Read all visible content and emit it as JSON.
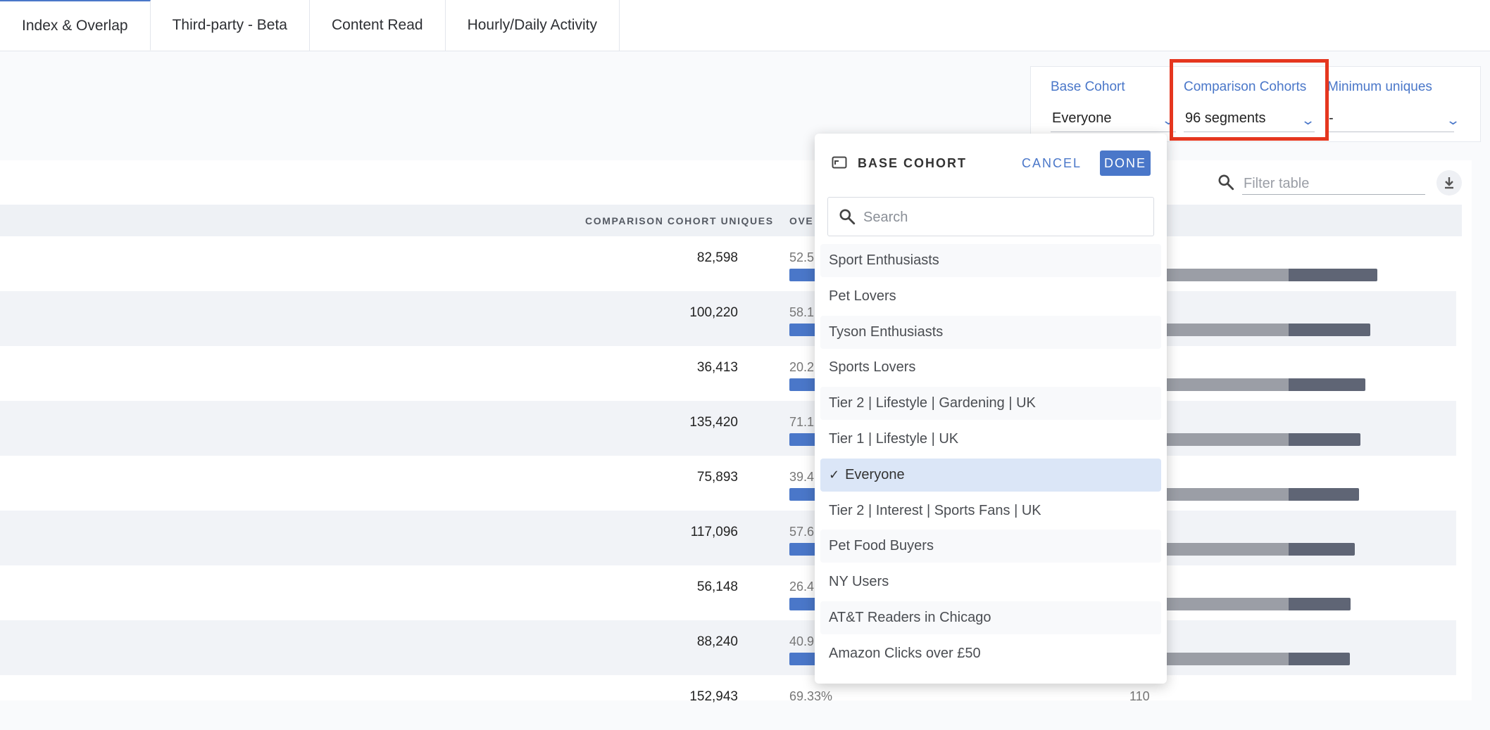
{
  "tabs": [
    {
      "label": "Index & Overlap",
      "active": true
    },
    {
      "label": "Third-party - Beta",
      "active": false
    },
    {
      "label": "Content Read",
      "active": false
    },
    {
      "label": "Hourly/Daily Activity",
      "active": false
    }
  ],
  "filters": {
    "base": {
      "label": "Base Cohort",
      "value": "Everyone"
    },
    "comparison": {
      "label": "Comparison Cohorts",
      "value": "96 segments"
    },
    "minimum": {
      "label": "Minimum uniques",
      "value": "-"
    }
  },
  "table": {
    "filter_placeholder": "Filter table",
    "headers": {
      "uniques": "COMPARISON COHORT UNIQUES",
      "overlap": "OVE"
    },
    "rows": [
      {
        "uniques": "82,598",
        "overlap": "52.5",
        "index_fraction": 0.74
      },
      {
        "uniques": "100,220",
        "overlap": "58.1",
        "index_fraction": 0.68
      },
      {
        "uniques": "36,413",
        "overlap": "20.2",
        "index_fraction": 0.64
      },
      {
        "uniques": "135,420",
        "overlap": "71.12",
        "index_fraction": 0.6
      },
      {
        "uniques": "75,893",
        "overlap": "39.4",
        "index_fraction": 0.59
      },
      {
        "uniques": "117,096",
        "overlap": "57.6",
        "index_fraction": 0.55
      },
      {
        "uniques": "56,148",
        "overlap": "26.4",
        "index_fraction": 0.52
      },
      {
        "uniques": "88,240",
        "overlap": "40.9",
        "index_fraction": 0.51
      },
      {
        "uniques": "152,943",
        "overlap": "69.33%",
        "index": "110",
        "index_fraction": 0.0
      }
    ]
  },
  "dropdown": {
    "title": "BASE COHORT",
    "cancel": "CANCEL",
    "done": "DONE",
    "search_placeholder": "Search",
    "items": [
      {
        "label": "Sport Enthusiasts",
        "selected": false
      },
      {
        "label": "Pet Lovers",
        "selected": false
      },
      {
        "label": "Tyson Enthusiasts",
        "selected": false
      },
      {
        "label": "Sports Lovers",
        "selected": false
      },
      {
        "label": "Tier 2 | Lifestyle | Gardening | UK",
        "selected": false
      },
      {
        "label": "Tier 1 | Lifestyle | UK",
        "selected": false
      },
      {
        "label": "Everyone",
        "selected": true
      },
      {
        "label": "Tier 2 | Interest | Sports Fans | UK",
        "selected": false
      },
      {
        "label": "Pet Food Buyers",
        "selected": false
      },
      {
        "label": "NY Users",
        "selected": false
      },
      {
        "label": "AT&T Readers in Chicago",
        "selected": false
      },
      {
        "label": "Amazon Clicks over £50",
        "selected": false
      }
    ]
  },
  "colors": {
    "accent": "#4a77c9",
    "highlight": "#e5361f"
  }
}
